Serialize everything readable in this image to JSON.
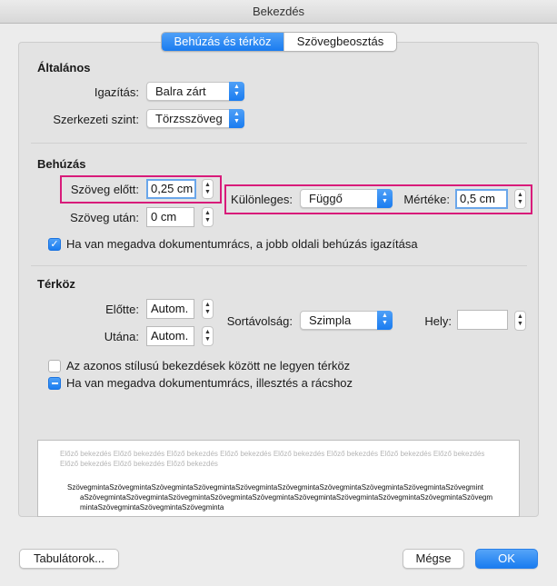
{
  "window": {
    "title": "Bekezdés"
  },
  "tabs": [
    {
      "label": "Behúzás és térköz",
      "active": true
    },
    {
      "label": "Szövegbeosztás",
      "active": false
    }
  ],
  "general": {
    "heading": "Általános",
    "alignment_label": "Igazítás:",
    "alignment_value": "Balra zárt",
    "outline_label": "Szerkezeti szint:",
    "outline_value": "Törzsszöveg"
  },
  "indentation": {
    "heading": "Behúzás",
    "before_label": "Szöveg előtt:",
    "before_value": "0,25 cm",
    "after_label": "Szöveg után:",
    "after_value": "0 cm",
    "special_label": "Különleges:",
    "special_value": "Függő",
    "by_label": "Mértéke:",
    "by_value": "0,5 cm",
    "grid_checkbox_label": "Ha van megadva dokumentumrács, a jobb oldali behúzás igazítása",
    "grid_checkbox_checked": true
  },
  "spacing": {
    "heading": "Térköz",
    "before_label": "Előtte:",
    "before_value": "Autom.",
    "after_label": "Utána:",
    "after_value": "Autom.",
    "line_spacing_label": "Sortávolság:",
    "line_spacing_value": "Szimpla",
    "at_label": "Hely:",
    "at_value": "",
    "no_space_checkbox_label": "Az azonos stílusú bekezdések között ne legyen térköz",
    "no_space_checked": false,
    "snap_grid_checkbox_label": "Ha van megadva dokumentumrács, illesztés a rácshoz",
    "snap_grid_state": "mixed"
  },
  "preview": {
    "previous_line1": "Előző bekezdés Előző bekezdés Előző bekezdés Előző bekezdés Előző bekezdés Előző bekezdés Előző bekezdés Előző bekezdés",
    "previous_line2": "Előző bekezdés Előző bekezdés Előző bekezdés",
    "sample_line1": "SzövegmintaSzövegmintaSzövegmintaSzövegmintaSzövegmintaSzövegmintaSzövegmintaSzövegmintaSzövegmintaSzövegmint",
    "sample_line2": "aSzövegmintaSzövegmintaSzövegmintaSzövegmintaSzövegmintaSzövegmintaSzövegmintaSzövegmintaSzövegmintaSzövegm",
    "sample_line3": "mintaSzövegmintaSzövegmintaSzövegminta"
  },
  "buttons": {
    "tabs": "Tabulátorok...",
    "cancel": "Mégse",
    "ok": "OK"
  },
  "colors": {
    "accent": "#1a7cf0",
    "highlight": "#d81b7a"
  }
}
